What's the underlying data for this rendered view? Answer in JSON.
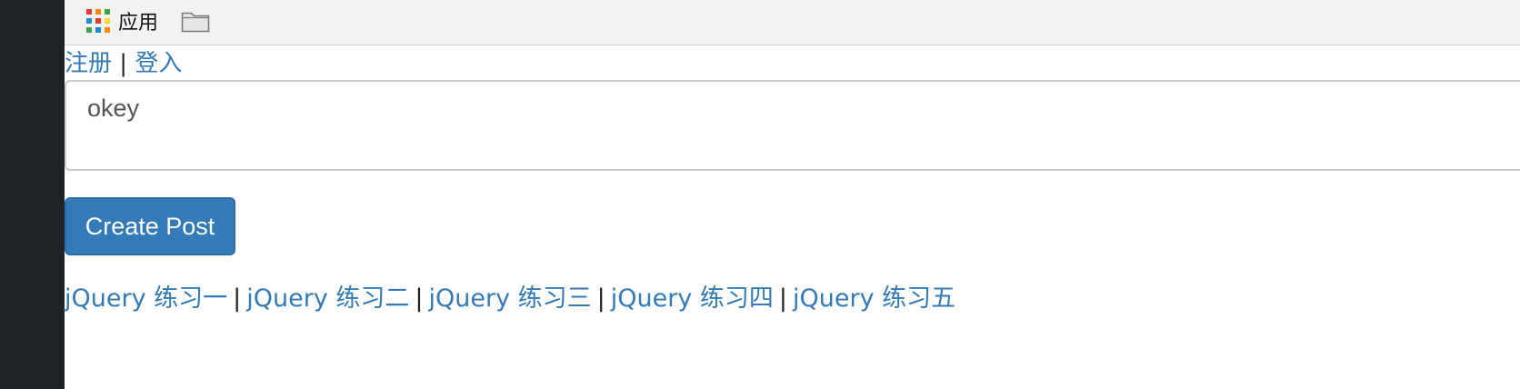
{
  "bookmarks_bar": {
    "apps_label": "应用",
    "apps_icon": "apps-grid-icon",
    "folder_icon": "folder-icon",
    "apps_grid_colors": [
      "#e53935",
      "#fb8c00",
      "#43a047",
      "#1e88e5",
      "#e53935",
      "#fdd835",
      "#43a047",
      "#1e88e5",
      "#fb8c00"
    ]
  },
  "auth": {
    "register_label": "注册",
    "separator": "|",
    "login_label": "登入"
  },
  "post_form": {
    "input_value": "okey",
    "submit_label": "Create Post"
  },
  "footer_links": {
    "items": [
      {
        "label": "jQuery 练习一"
      },
      {
        "label": "jQuery 练习二"
      },
      {
        "label": "jQuery 练习三"
      },
      {
        "label": "jQuery 练习四"
      },
      {
        "label": "jQuery 练习五"
      }
    ],
    "separator": "|"
  },
  "colors": {
    "link": "#337ab7",
    "button_bg": "#337ab7",
    "button_border": "#2e6da4",
    "bookmarks_bg": "#f2f2f2",
    "left_strip": "#1f2328"
  }
}
